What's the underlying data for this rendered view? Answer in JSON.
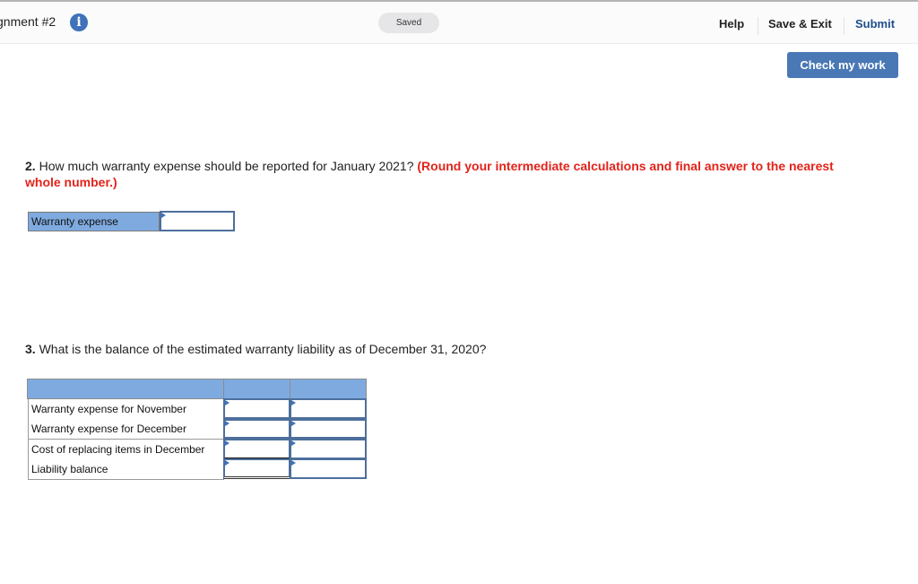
{
  "header": {
    "title": "gnment #2",
    "info_icon": "info-icon",
    "status": "Saved",
    "nav": {
      "help": "Help",
      "save_exit": "Save & Exit",
      "submit": "Submit"
    },
    "check_my_work": "Check my work"
  },
  "question2": {
    "number": "2.",
    "text": " How much warranty expense should be reported for January 2021? ",
    "note": "(Round your intermediate calculations and final answer to the nearest whole number.)",
    "table": {
      "label": "Warranty expense",
      "value": ""
    }
  },
  "question3": {
    "number": "3.",
    "text": " What is the balance of the estimated warranty liability as of December 31, 2020?",
    "table": {
      "headers": [
        "",
        "",
        ""
      ],
      "rows": [
        {
          "label": "Warranty expense for November",
          "col1": "",
          "col2": ""
        },
        {
          "label": "Warranty expense for December",
          "col1": "",
          "col2": ""
        },
        {
          "label": "Cost of replacing items in December",
          "col1": "",
          "col2": ""
        },
        {
          "label": "Liability balance",
          "col1": "",
          "col2": ""
        }
      ]
    }
  },
  "colors": {
    "accent": "#4a78b5",
    "submit_text": "#1f4e8c",
    "note_red": "#e2231a",
    "table_header": "#7faadf"
  }
}
